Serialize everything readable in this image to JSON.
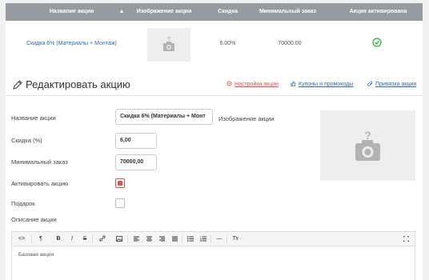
{
  "table": {
    "headers": {
      "name": "Название акции",
      "image": "Изображение акции",
      "discount": "Скидка",
      "min_order": "Минимальный заказ",
      "active": "Акция активирована"
    },
    "rows": [
      {
        "name": "Скидка 6% (Материалы + Монтаж)",
        "discount": "6.00%",
        "min_order": "70000.00",
        "active": true
      }
    ]
  },
  "edit": {
    "title": "Редактировать акцию",
    "links": {
      "settings": "Настройки акции",
      "coupons": "Купоны и промокоды",
      "binding": "Привязка акции"
    },
    "fields": {
      "name_label": "Название акции",
      "name_value": "Скидка 6% (Материалы + Монт",
      "discount_label": "Скидка (%)",
      "discount_value": "6,00",
      "min_order_label": "Минимальный заказ",
      "min_order_value": "70000,00",
      "activate_label": "Активировать акцию",
      "activate_checked": true,
      "gift_label": "Подарок",
      "gift_checked": false,
      "image_label": "Изображение акции",
      "description_label": "Описание акции"
    },
    "editor": {
      "toolbar": [
        "<>",
        "¶",
        "B",
        "I",
        "S",
        "link-icon",
        "image-icon",
        "align-left-icon",
        "align-center-icon",
        "align-right-icon",
        "align-justify-icon",
        "bullet-list-icon",
        "numbered-list-icon",
        "—",
        "Tx",
        "fullscreen-icon"
      ],
      "content": "Базовая акция"
    }
  },
  "colors": {
    "header_bg": "#969ba1",
    "accent_red": "#d9534f",
    "link_blue": "#2f6ba8",
    "success_green": "#2eb344"
  }
}
